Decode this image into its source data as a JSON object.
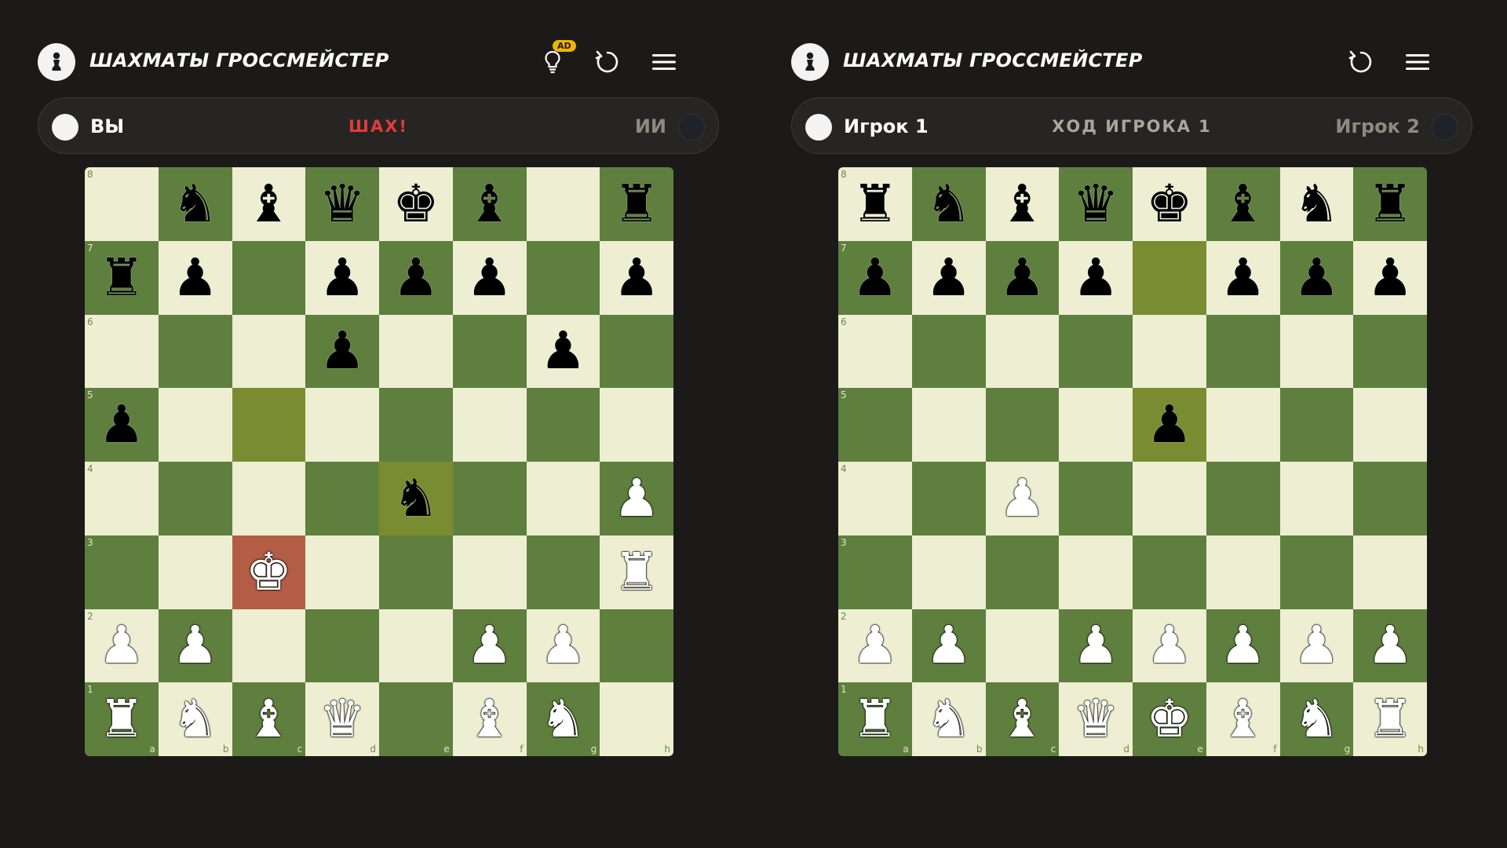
{
  "colors": {
    "background": "#1c1a19",
    "light_square": "#eeeed2",
    "dark_square": "#5e7f3e",
    "highlight_square": "#7a8c32",
    "check_square": "#b35d45",
    "check_text": "#e03b3b",
    "ad_badge": "#f0b400"
  },
  "icons": {
    "logo": "pawn-logo-icon",
    "hint": "lightbulb-icon",
    "restart": "restart-icon",
    "menu": "hamburger-menu-icon"
  },
  "panels": [
    {
      "app_title": "ШАХМАТЫ ГРОССМЕЙСТЕР",
      "show_hint": true,
      "ad_badge": "AD",
      "player_left": "ВЫ",
      "player_right": "ИИ",
      "status_text": "ШАХ!",
      "status_type": "check",
      "files": [
        "a",
        "b",
        "c",
        "d",
        "e",
        "f",
        "g",
        "h"
      ],
      "ranks": [
        "8",
        "7",
        "6",
        "5",
        "4",
        "3",
        "2",
        "1"
      ],
      "board": [
        [
          "",
          "bN",
          "bB",
          "bQ",
          "bK",
          "bB",
          "",
          "bR"
        ],
        [
          "bR",
          "bP",
          "",
          "bP",
          "bP",
          "bP",
          "",
          "bP"
        ],
        [
          "",
          "",
          "",
          "bP",
          "",
          "",
          "bP",
          ""
        ],
        [
          "bP",
          "",
          "",
          "",
          "",
          "",
          "",
          ""
        ],
        [
          "",
          "",
          "",
          "",
          "bN",
          "",
          "",
          "wP"
        ],
        [
          "",
          "",
          "wK",
          "",
          "",
          "",
          "",
          "wR"
        ],
        [
          "wP",
          "wP",
          "",
          "",
          "",
          "wP",
          "wP",
          ""
        ],
        [
          "wR",
          "wN",
          "wB",
          "wQ",
          "",
          "wB",
          "wN",
          ""
        ]
      ],
      "highlights": [
        "c5",
        "e4"
      ],
      "check_square": "c3"
    },
    {
      "app_title": "ШАХМАТЫ ГРОССМЕЙСТЕР",
      "show_hint": false,
      "ad_badge": "",
      "player_left": "Игрок 1",
      "player_right": "Игрок 2",
      "status_text": "ХОД ИГРОКА 1",
      "status_type": "turn",
      "files": [
        "a",
        "b",
        "c",
        "d",
        "e",
        "f",
        "g",
        "h"
      ],
      "ranks": [
        "8",
        "7",
        "6",
        "5",
        "4",
        "3",
        "2",
        "1"
      ],
      "board": [
        [
          "bR",
          "bN",
          "bB",
          "bQ",
          "bK",
          "bB",
          "bN",
          "bR"
        ],
        [
          "bP",
          "bP",
          "bP",
          "bP",
          "",
          "bP",
          "bP",
          "bP"
        ],
        [
          "",
          "",
          "",
          "",
          "",
          "",
          "",
          ""
        ],
        [
          "",
          "",
          "",
          "",
          "bP",
          "",
          "",
          ""
        ],
        [
          "",
          "",
          "wP",
          "",
          "",
          "",
          "",
          ""
        ],
        [
          "",
          "",
          "",
          "",
          "",
          "",
          "",
          ""
        ],
        [
          "wP",
          "wP",
          "",
          "wP",
          "wP",
          "wP",
          "wP",
          "wP"
        ],
        [
          "wR",
          "wN",
          "wB",
          "wQ",
          "wK",
          "wB",
          "wN",
          "wR"
        ]
      ],
      "highlights": [
        "e7",
        "e5"
      ],
      "check_square": ""
    }
  ]
}
